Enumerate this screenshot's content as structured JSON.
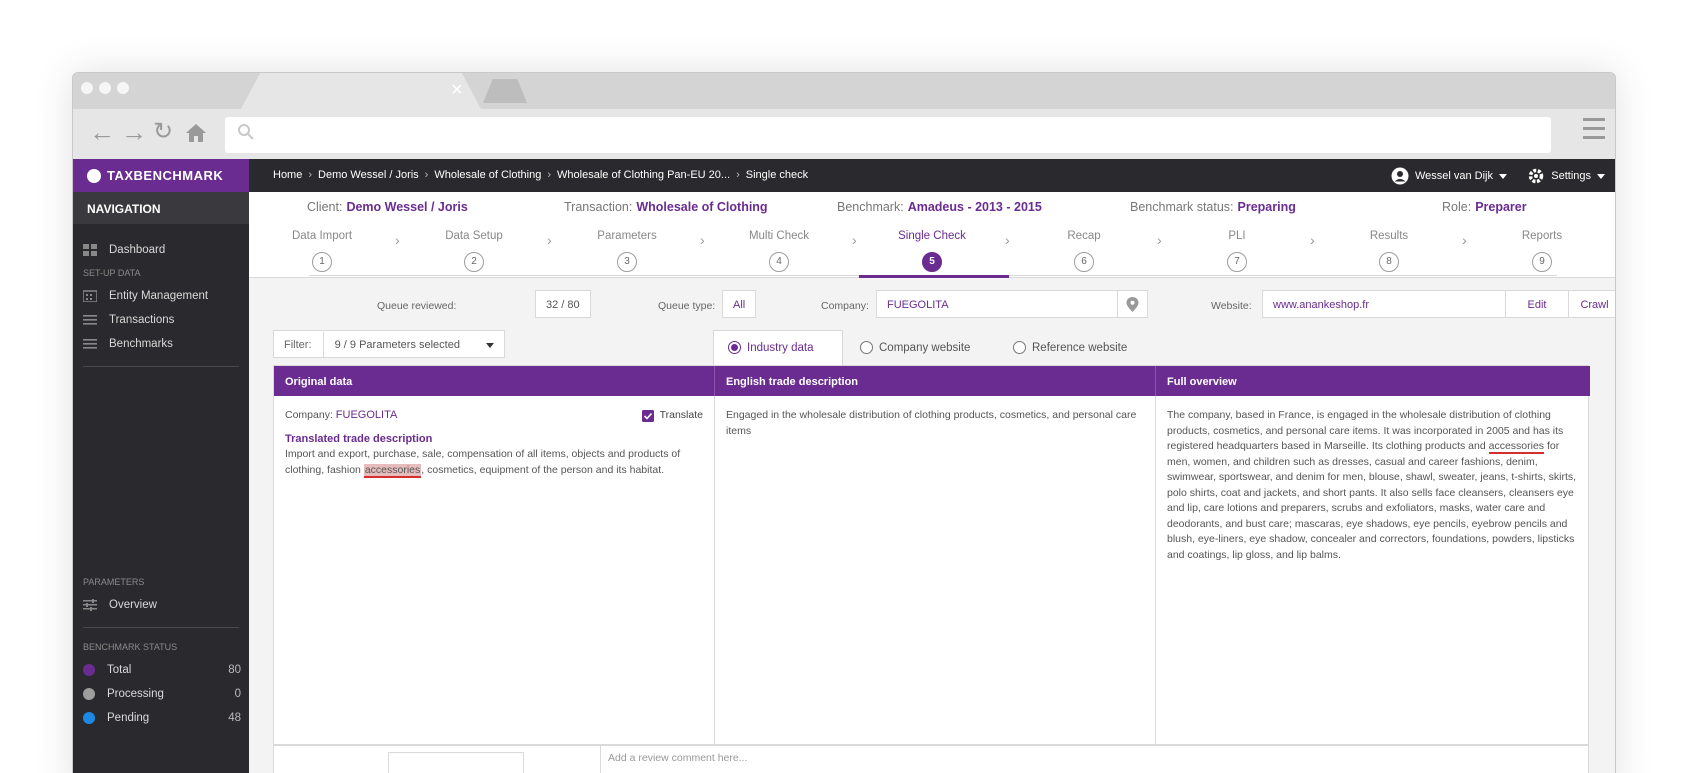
{
  "app": {
    "brand": "TAXBENCHMARK",
    "navigation_title": "NAVIGATION"
  },
  "sidebar": {
    "items_main": [
      {
        "label": "Dashboard",
        "icon": "dashboard-icon"
      }
    ],
    "setup_section": "SET-UP DATA",
    "setup_items": [
      {
        "label": "Entity Management",
        "icon": "building-icon"
      },
      {
        "label": "Transactions",
        "icon": "list-icon"
      },
      {
        "label": "Benchmarks",
        "icon": "list-icon"
      }
    ],
    "parameters_section": "PARAMETERS",
    "parameters_items": [
      {
        "label": "Overview",
        "icon": "sliders-icon"
      }
    ],
    "status_section": "BENCHMARK STATUS",
    "status_items": [
      {
        "label": "Total",
        "count": "80",
        "color": "#6a2c91"
      },
      {
        "label": "Processing",
        "count": "0",
        "color": "#9e9e9e"
      },
      {
        "label": "Pending",
        "count": "48",
        "color": "#1e88e5"
      }
    ]
  },
  "breadcrumb": [
    "Home",
    "Demo Wessel / Joris",
    "Wholesale of Clothing",
    "Wholesale of Clothing Pan-EU 20...",
    "Single check"
  ],
  "user": {
    "name": "Wessel van Dijk",
    "settings_label": "Settings"
  },
  "info": {
    "client_label": "Client:",
    "client": "Demo Wessel / Joris",
    "transaction_label": "Transaction:",
    "transaction": "Wholesale of Clothing",
    "benchmark_label": "Benchmark:",
    "benchmark": "Amadeus - 2013 - 2015",
    "status_label": "Benchmark status:",
    "status": "Preparing",
    "role_label": "Role:",
    "role": "Preparer"
  },
  "steps": [
    {
      "label": "Data Import",
      "num": "1"
    },
    {
      "label": "Data Setup",
      "num": "2"
    },
    {
      "label": "Parameters",
      "num": "3"
    },
    {
      "label": "Multi Check",
      "num": "4"
    },
    {
      "label": "Single Check",
      "num": "5"
    },
    {
      "label": "Recap",
      "num": "6"
    },
    {
      "label": "PLI",
      "num": "7"
    },
    {
      "label": "Results",
      "num": "8"
    },
    {
      "label": "Reports",
      "num": "9"
    }
  ],
  "active_step": 5,
  "queue": {
    "reviewed_label": "Queue reviewed:",
    "reviewed": "32 / 80",
    "type_label": "Queue type:",
    "type": "All"
  },
  "company": {
    "label": "Company:",
    "value": "FUEGOLITA"
  },
  "website": {
    "label": "Website:",
    "value": "www.anankeshop.fr",
    "edit": "Edit",
    "crawl": "Crawl"
  },
  "filter": {
    "label": "Filter:",
    "value": "9 / 9 Parameters selected"
  },
  "view_tabs": [
    "Industry data",
    "Company website",
    "Reference website"
  ],
  "columns": {
    "original": "Original data",
    "english": "English trade description",
    "overview": "Full overview"
  },
  "original": {
    "company_label": "Company:",
    "company": "FUEGOLITA",
    "translate_label": "Translate",
    "translated_title": "Translated trade description",
    "text_before": "Import and export, purchase, sale, compensation of all items, objects and products of clothing, fashion ",
    "highlight": "accessories",
    "text_after": ", cosmetics, equipment of the person and its habitat."
  },
  "english_text": "Engaged in the wholesale distribution of clothing products, cosmetics, and personal care items",
  "overview": {
    "text_before": "The company, based in France, is engaged in the wholesale distribution of clothing products, cosmetics, and personal care items. It was incorporated in 2005 and has its registered headquarters based in Marseille. Its clothing products and ",
    "highlight": "accessories",
    "text_after": " for men, women, and children such as dresses, casual and career fashions, denim, swimwear, sportswear, and denim for men, blouse, shawl, sweater, jeans, t-shirts, skirts, polo shirts, coat and jackets, and short pants. It also sells face cleansers, cleansers eye and lip, care lotions and preparers, scrubs and exfoliators, masks, water care and deodorants, and bust care; mascaras, eye shadows, eye pencils, eyebrow pencils and blush, eye-liners, eye shadow, concealer and correctors, foundations, powders, lipsticks and coatings, lip gloss, and lip balms."
  },
  "comment_placeholder": "Add a review comment here..."
}
